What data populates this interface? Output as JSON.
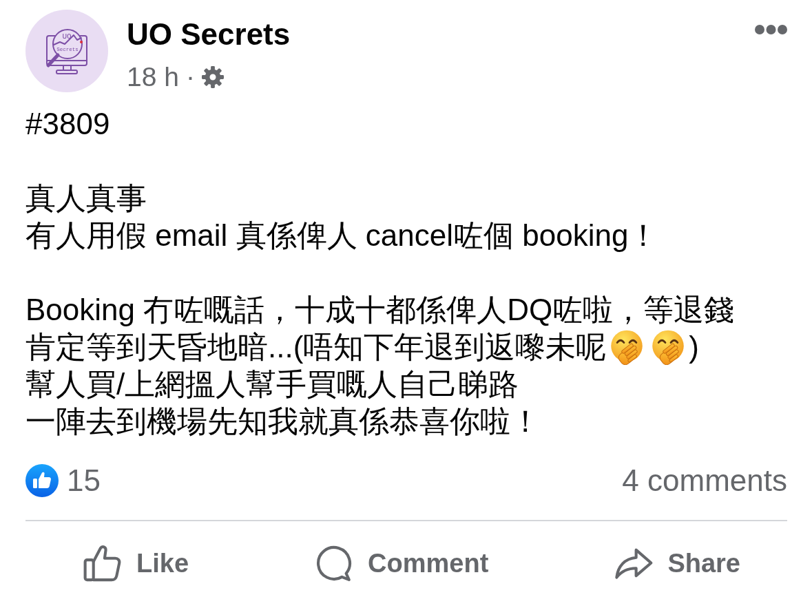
{
  "post": {
    "author": {
      "name": "UO Secrets",
      "logo_text": [
        "UO",
        "Secrets"
      ]
    },
    "meta": {
      "time": "18 h",
      "separator": "·"
    },
    "body": [
      [
        "#3809"
      ],
      [
        "真人真事",
        "有人用假 email 真係俾人 cancel咗個 booking！"
      ],
      [
        "Booking 冇咗嘅話，十成十都係俾人DQ咗啦，等退錢",
        {
          "segments": [
            {
              "kind": "text",
              "text": "肯定等到天昏地暗...(唔知下年退到返嚟未呢"
            },
            {
              "kind": "emoji"
            },
            {
              "kind": "emoji"
            },
            {
              "kind": "text",
              "text": ")"
            }
          ]
        },
        "幫人買/上網搵人幫手買嘅人自己睇路",
        "一陣去到機場先知我就真係恭喜你啦！"
      ]
    ]
  },
  "stats": {
    "likes": "15",
    "comments": "4 comments"
  },
  "actions": [
    {
      "kind": "like",
      "label": "Like"
    },
    {
      "kind": "comment",
      "label": "Comment"
    },
    {
      "kind": "share",
      "label": "Share"
    }
  ]
}
